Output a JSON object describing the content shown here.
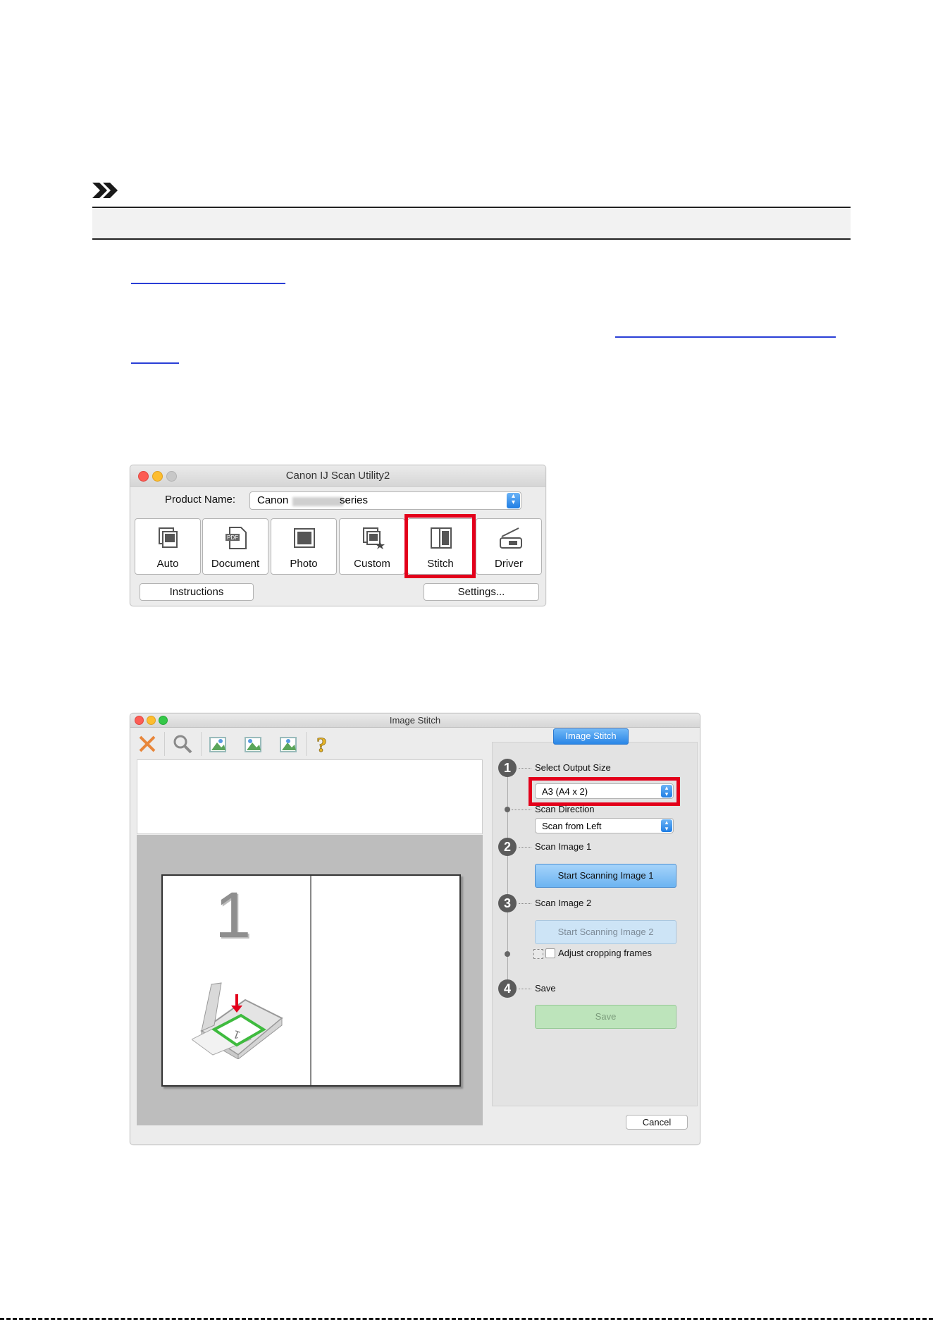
{
  "window_main": {
    "title": "Canon IJ Scan Utility2",
    "product_name_label": "Product Name:",
    "product_prefix": "Canon",
    "product_suffix": "series",
    "tiles": [
      "Auto",
      "Document",
      "Photo",
      "Custom",
      "Stitch",
      "Driver"
    ],
    "instructions_label": "Instructions",
    "settings_label": "Settings...",
    "doc_icon_text": "PDF"
  },
  "window_stitch": {
    "title": "Image Stitch",
    "tab_label": "Image Stitch",
    "step1_label": "Select Output Size",
    "output_size_value": "A3 (A4 x 2)",
    "scan_direction_label": "Scan Direction",
    "scan_direction_value": "Scan from Left",
    "step2_label": "Scan Image 1",
    "start_scan1_label": "Start Scanning Image 1",
    "step3_label": "Scan Image 2",
    "start_scan2_label": "Start Scanning Image 2",
    "adjust_label": "Adjust cropping frames",
    "step4_label": "Save",
    "save_label": "Save",
    "cancel_label": "Cancel",
    "preview_number": "1",
    "steps": [
      "1",
      "2",
      "3",
      "4"
    ]
  },
  "colors": {
    "highlight": "#e3001b",
    "link": "#2a3fd6",
    "primary_button": "#7cbcf2",
    "save_button": "#b9e2b7"
  }
}
